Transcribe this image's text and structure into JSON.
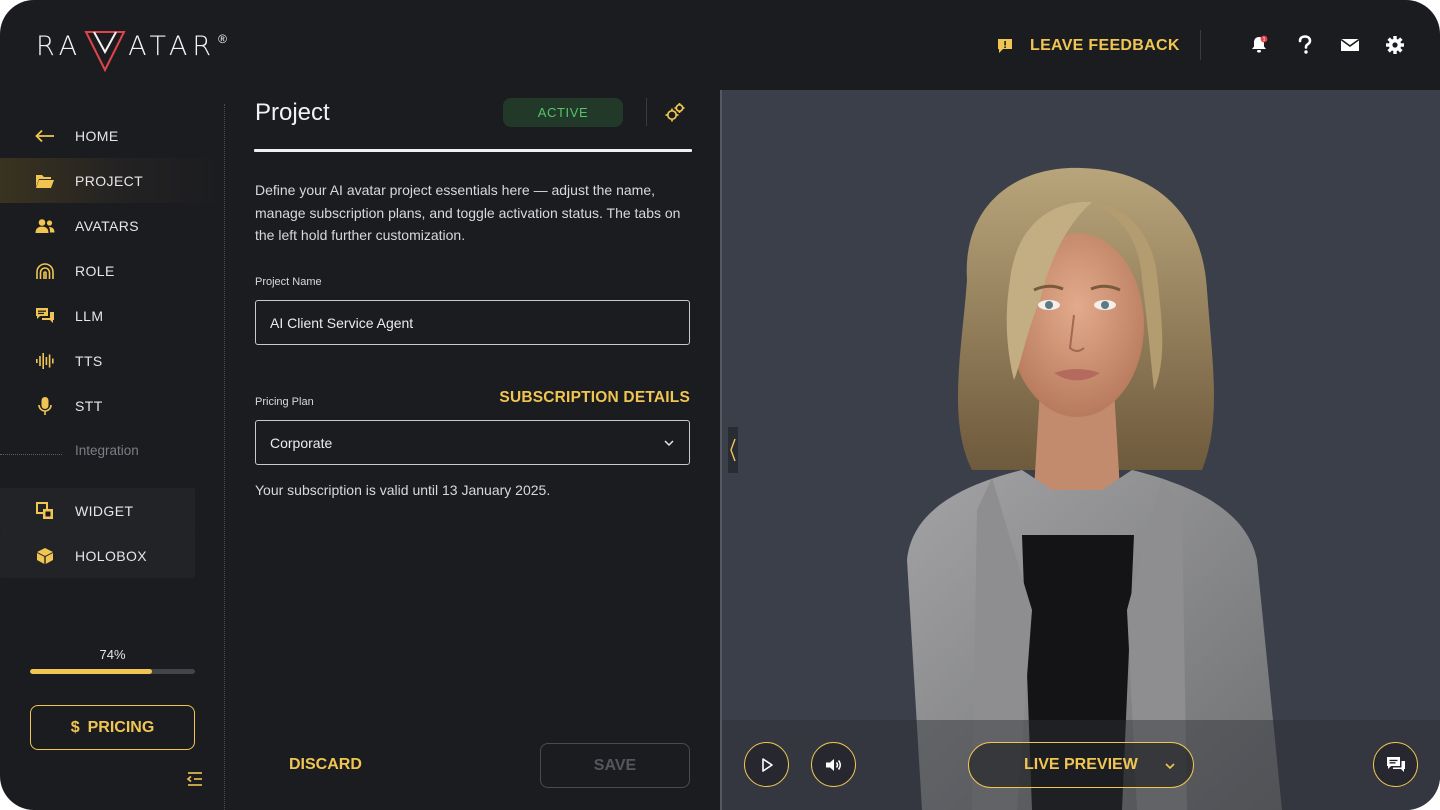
{
  "brand": {
    "logo_left": "RA",
    "logo_right": "ATAR",
    "registered": "®"
  },
  "topbar": {
    "feedback_label": "LEAVE FEEDBACK",
    "notification_count": "1"
  },
  "sidebar": {
    "items": [
      {
        "label": "HOME",
        "icon": "arrow-left-icon"
      },
      {
        "label": "PROJECT",
        "icon": "folder-open-icon"
      },
      {
        "label": "AVATARS",
        "icon": "users-icon"
      },
      {
        "label": "ROLE",
        "icon": "fingerprint-icon"
      },
      {
        "label": "LLM",
        "icon": "chat-bubbles-icon"
      },
      {
        "label": "TTS",
        "icon": "waveform-icon"
      },
      {
        "label": "STT",
        "icon": "microphone-icon"
      }
    ],
    "section_label": "Integration",
    "integration_items": [
      {
        "label": "WIDGET",
        "icon": "widget-icon"
      },
      {
        "label": "HOLOBOX",
        "icon": "box-icon"
      }
    ],
    "progress_label": "74%",
    "progress_value": 74,
    "pricing_symbol": "$",
    "pricing_label": "PRICING"
  },
  "project": {
    "title": "Project",
    "status": "ACTIVE",
    "description": "Define your AI avatar project essentials here — adjust the name, manage subscription plans, and toggle activation status. The tabs on the left hold further customization.",
    "name_label": "Project Name",
    "name_value": "AI Client Service Agent",
    "plan_label": "Pricing Plan",
    "subscription_link": "SUBSCRIPTION DETAILS",
    "plan_value": "Corporate",
    "valid_text": "Your subscription is valid until 13 January 2025.",
    "discard_label": "DISCARD",
    "save_label": "SAVE"
  },
  "preview": {
    "live_preview_label": "LIVE PREVIEW"
  },
  "colors": {
    "accent": "#f0c552",
    "background": "#1b1c20",
    "active_green": "#55c46a",
    "preview_bg": "#3b3f4a"
  }
}
